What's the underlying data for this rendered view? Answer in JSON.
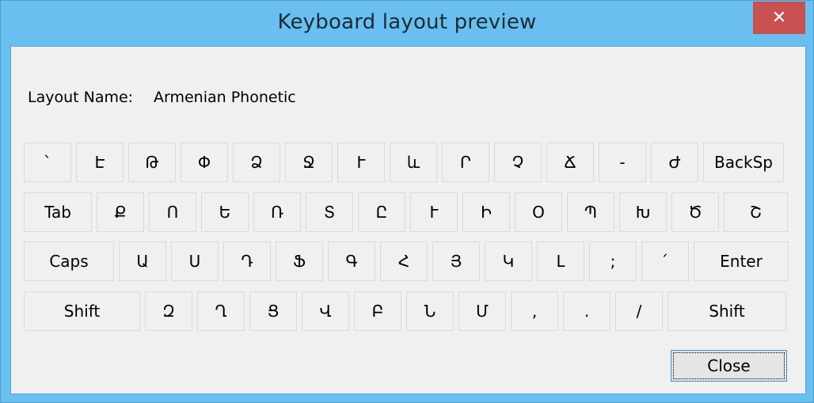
{
  "window": {
    "title": "Keyboard layout preview",
    "close_glyph": "✕"
  },
  "layout": {
    "label": "Layout Name:",
    "value": "Armenian Phonetic"
  },
  "keyboard": {
    "rows": [
      [
        "`",
        "Է",
        "Թ",
        "Փ",
        "Ձ",
        "Ջ",
        "Ւ",
        "և",
        "Ր",
        "Չ",
        "Ճ",
        "-",
        "Ժ",
        "BackSp"
      ],
      [
        "Tab",
        "Ք",
        "Ո",
        "Ե",
        "Ռ",
        "Տ",
        "Ը",
        "Ւ",
        "Ի",
        "Օ",
        "Պ",
        "Խ",
        "Ծ",
        "Շ"
      ],
      [
        "Caps",
        "Ա",
        "Ս",
        "Դ",
        "Ֆ",
        "Գ",
        "Հ",
        "Յ",
        "Կ",
        "Լ",
        ";",
        "՛",
        "Enter"
      ],
      [
        "Shift",
        "Զ",
        "Ղ",
        "Ց",
        "Վ",
        "Բ",
        "Ն",
        "Մ",
        ",",
        ".",
        "/",
        "Shift"
      ]
    ]
  },
  "buttons": {
    "close_label": "Close"
  },
  "colors": {
    "titlebar": "#68bff0",
    "close_hover": "#c75050",
    "focus_border": "#3c8fdc"
  }
}
